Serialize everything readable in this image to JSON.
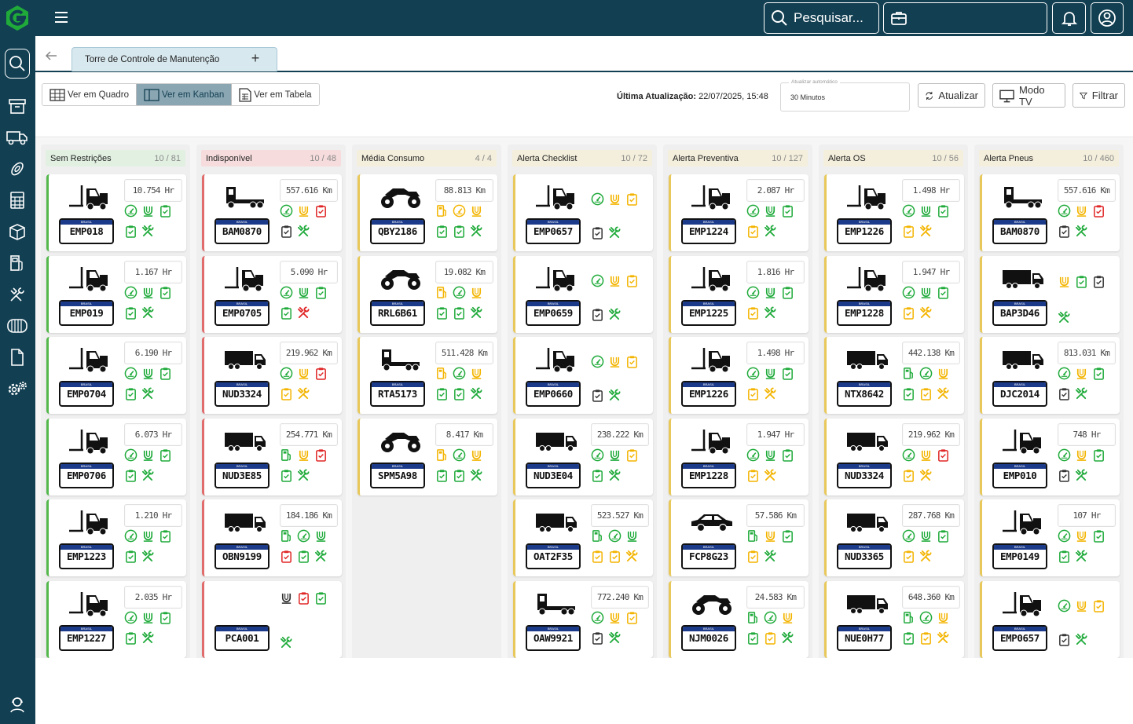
{
  "colors": {
    "brand": "#123f52",
    "green": "#1faa3a",
    "yellow": "#f3b400",
    "red": "#e02626"
  },
  "topbar": {
    "search_label": "Pesquisar..."
  },
  "tabs": {
    "active_label": "Torre de Controle de Manutenção",
    "add_label": "+"
  },
  "toolbar": {
    "views": [
      {
        "label": "Ver em Quadro"
      },
      {
        "label": "Ver em Kanban"
      },
      {
        "label": "Ver em Tabela"
      }
    ],
    "last_update_label": "Última Atualização:",
    "last_update_value": "22/07/2025, 15:48",
    "auto_update_legend": "Atualizar automático",
    "auto_update_value": "30 Minutos",
    "refresh_label": "Atualizar",
    "tv_label": "Modo TV",
    "filter_label": "Filtrar"
  },
  "plate_band_text": "BRASIL",
  "columns": [
    {
      "title": "Sem Restrições",
      "count": "10 / 81",
      "color": "green",
      "cards": [
        {
          "vehicle": "forklift",
          "plate": "EMP018",
          "meter": "10.754 Hr",
          "row1": [
            "gauge:g",
            "tire:g",
            "clip:g"
          ],
          "row2": [
            "clip:g",
            "tools:g"
          ]
        },
        {
          "vehicle": "forklift",
          "plate": "EMP019",
          "meter": "1.167 Hr",
          "row1": [
            "gauge:g",
            "tire:g",
            "clip:g"
          ],
          "row2": [
            "clip:g",
            "tools:g"
          ]
        },
        {
          "vehicle": "forklift",
          "plate": "EMP0704",
          "meter": "6.190 Hr",
          "row1": [
            "gauge:g",
            "tire:g",
            "clip:g"
          ],
          "row2": [
            "clip:g",
            "tools:g"
          ]
        },
        {
          "vehicle": "forklift",
          "plate": "EMP0706",
          "meter": "6.073 Hr",
          "row1": [
            "gauge:g",
            "tire:g",
            "clip:g"
          ],
          "row2": [
            "clip:g",
            "tools:g"
          ]
        },
        {
          "vehicle": "forklift",
          "plate": "EMP1223",
          "meter": "1.210 Hr",
          "row1": [
            "gauge:g",
            "tire:g",
            "clip:g"
          ],
          "row2": [
            "clip:g",
            "tools:g"
          ]
        },
        {
          "vehicle": "forklift",
          "plate": "EMP1227",
          "meter": "2.035 Hr",
          "row1": [
            "gauge:g",
            "tire:g",
            "clip:g"
          ],
          "row2": [
            "clip:g",
            "tools:g"
          ]
        }
      ]
    },
    {
      "title": "Indisponível",
      "count": "10 / 48",
      "color": "red",
      "cards": [
        {
          "vehicle": "tractor",
          "plate": "BAM0870",
          "meter": "557.616 Km",
          "row1": [
            "gauge:g",
            "tire:y",
            "clip:r"
          ],
          "row2": [
            "clip:k",
            "tools:g"
          ]
        },
        {
          "vehicle": "forklift",
          "plate": "EMP0705",
          "meter": "5.090 Hr",
          "row1": [
            "gauge:g",
            "tire:g",
            "clip:g"
          ],
          "row2": [
            "clip:g",
            "tools:r"
          ]
        },
        {
          "vehicle": "truck",
          "plate": "NUD3324",
          "meter": "219.962 Km",
          "row1": [
            "gauge:g",
            "tire:y",
            "clip:r"
          ],
          "row2": [
            "clip:y",
            "tools:y"
          ]
        },
        {
          "vehicle": "truck",
          "plate": "NUD3E85",
          "meter": "254.771 Km",
          "row1": [
            "fuel:g",
            "tire:y",
            "clip:r"
          ],
          "row2": [
            "clip:g",
            "tools:g"
          ]
        },
        {
          "vehicle": "truck",
          "plate": "OBN9199",
          "meter": "184.186 Km",
          "row1": [
            "fuel:g",
            "gauge:g",
            "tire:g"
          ],
          "row2": [
            "clip:r",
            "clip:g",
            "tools:g"
          ]
        },
        {
          "vehicle": "none",
          "plate": "PCA001",
          "meter": "",
          "row1": [
            "tire:k",
            "clip:r",
            "clip:g"
          ],
          "row2": [
            "tools:g"
          ]
        }
      ]
    },
    {
      "title": "Média Consumo",
      "count": "4 / 4",
      "color": "yellow",
      "cards": [
        {
          "vehicle": "atv",
          "plate": "QBY2186",
          "meter": "88.813 Km",
          "row1": [
            "fuel:y",
            "gauge:y",
            "tire:y"
          ],
          "row2": [
            "clip:g",
            "clip:g",
            "tools:g"
          ]
        },
        {
          "vehicle": "atv",
          "plate": "RRL6B61",
          "meter": "19.082 Km",
          "row1": [
            "fuel:y",
            "gauge:g",
            "tire:y"
          ],
          "row2": [
            "clip:g",
            "clip:g",
            "tools:g"
          ]
        },
        {
          "vehicle": "tractor",
          "plate": "RTA5173",
          "meter": "511.428 Km",
          "row1": [
            "fuel:y",
            "gauge:g",
            "tire:y"
          ],
          "row2": [
            "clip:g",
            "clip:g",
            "tools:g"
          ]
        },
        {
          "vehicle": "atv",
          "plate": "SPM5A98",
          "meter": "8.417 Km",
          "row1": [
            "fuel:y",
            "gauge:g",
            "tire:y"
          ],
          "row2": [
            "clip:g",
            "clip:g",
            "tools:g"
          ]
        }
      ]
    },
    {
      "title": "Alerta Checklist",
      "count": "10 / 72",
      "color": "yellow",
      "cards": [
        {
          "vehicle": "forklift",
          "plate": "EMP0657",
          "meter": "",
          "row1": [
            "gauge:g",
            "tire:y",
            "clip:y"
          ],
          "row2": [
            "clip:k",
            "tools:g"
          ]
        },
        {
          "vehicle": "forklift",
          "plate": "EMP0659",
          "meter": "",
          "row1": [
            "gauge:g",
            "tire:y",
            "clip:y"
          ],
          "row2": [
            "clip:k",
            "tools:g"
          ]
        },
        {
          "vehicle": "forklift",
          "plate": "EMP0660",
          "meter": "",
          "row1": [
            "gauge:g",
            "tire:y",
            "clip:y"
          ],
          "row2": [
            "clip:k",
            "tools:g"
          ]
        },
        {
          "vehicle": "truck",
          "plate": "NUD3E04",
          "meter": "238.222 Km",
          "row1": [
            "gauge:g",
            "tire:g",
            "clip:y"
          ],
          "row2": [
            "clip:g",
            "tools:g"
          ]
        },
        {
          "vehicle": "truck",
          "plate": "OAT2F35",
          "meter": "523.527 Km",
          "row1": [
            "fuel:g",
            "gauge:g",
            "tire:g"
          ],
          "row2": [
            "clip:y",
            "clip:y",
            "tools:y"
          ]
        },
        {
          "vehicle": "tractor",
          "plate": "OAW9921",
          "meter": "772.240 Km",
          "row1": [
            "gauge:g",
            "tire:y",
            "clip:y"
          ],
          "row2": [
            "clip:k",
            "tools:g"
          ]
        }
      ]
    },
    {
      "title": "Alerta Preventiva",
      "count": "10 / 127",
      "color": "yellow",
      "cards": [
        {
          "vehicle": "forklift",
          "plate": "EMP1224",
          "meter": "2.087 Hr",
          "row1": [
            "gauge:g",
            "tire:g",
            "clip:g"
          ],
          "row2": [
            "clip:y",
            "tools:g"
          ]
        },
        {
          "vehicle": "forklift",
          "plate": "EMP1225",
          "meter": "1.816 Hr",
          "row1": [
            "gauge:g",
            "tire:g",
            "clip:g"
          ],
          "row2": [
            "clip:y",
            "tools:g"
          ]
        },
        {
          "vehicle": "forklift",
          "plate": "EMP1226",
          "meter": "1.498 Hr",
          "row1": [
            "gauge:g",
            "tire:g",
            "clip:g"
          ],
          "row2": [
            "clip:y",
            "tools:y"
          ]
        },
        {
          "vehicle": "forklift",
          "plate": "EMP1228",
          "meter": "1.947 Hr",
          "row1": [
            "gauge:g",
            "tire:g",
            "clip:g"
          ],
          "row2": [
            "clip:y",
            "tools:y"
          ]
        },
        {
          "vehicle": "car",
          "plate": "FCP8G23",
          "meter": "57.586 Km",
          "row1": [
            "fuel:g",
            "tire:y",
            "clip:g"
          ],
          "row2": [
            "clip:y",
            "tools:g"
          ]
        },
        {
          "vehicle": "atv",
          "plate": "NJM0026",
          "meter": "24.583 Km",
          "row1": [
            "fuel:g",
            "gauge:g",
            "tire:y"
          ],
          "row2": [
            "clip:g",
            "clip:y",
            "tools:g"
          ]
        }
      ]
    },
    {
      "title": "Alerta OS",
      "count": "10 / 56",
      "color": "yellow",
      "cards": [
        {
          "vehicle": "forklift",
          "plate": "EMP1226",
          "meter": "1.498 Hr",
          "row1": [
            "gauge:g",
            "tire:g",
            "clip:g"
          ],
          "row2": [
            "clip:y",
            "tools:y"
          ]
        },
        {
          "vehicle": "forklift",
          "plate": "EMP1228",
          "meter": "1.947 Hr",
          "row1": [
            "gauge:g",
            "tire:g",
            "clip:g"
          ],
          "row2": [
            "clip:y",
            "tools:y"
          ]
        },
        {
          "vehicle": "truck",
          "plate": "NTX8642",
          "meter": "442.138 Km",
          "row1": [
            "fuel:g",
            "gauge:g",
            "tire:y"
          ],
          "row2": [
            "clip:g",
            "clip:y",
            "tools:y"
          ]
        },
        {
          "vehicle": "truck",
          "plate": "NUD3324",
          "meter": "219.962 Km",
          "row1": [
            "gauge:g",
            "tire:y",
            "clip:r"
          ],
          "row2": [
            "clip:y",
            "tools:y"
          ]
        },
        {
          "vehicle": "truck",
          "plate": "NUD3365",
          "meter": "287.768 Km",
          "row1": [
            "gauge:g",
            "tire:g",
            "clip:g"
          ],
          "row2": [
            "clip:y",
            "tools:y"
          ]
        },
        {
          "vehicle": "truck",
          "plate": "NUE0H77",
          "meter": "648.360 Km",
          "row1": [
            "fuel:g",
            "gauge:g",
            "tire:y"
          ],
          "row2": [
            "clip:g",
            "clip:y",
            "tools:y"
          ]
        }
      ]
    },
    {
      "title": "Alerta Pneus",
      "count": "10 / 460",
      "color": "yellow",
      "cards": [
        {
          "vehicle": "tractor",
          "plate": "BAM0870",
          "meter": "557.616 Km",
          "row1": [
            "gauge:g",
            "tire:y",
            "clip:r"
          ],
          "row2": [
            "clip:k",
            "tools:g"
          ]
        },
        {
          "vehicle": "truck",
          "plate": "BAP3D46",
          "meter": "",
          "row1": [
            "tire:y",
            "clip:g",
            "clip:k"
          ],
          "row2": [
            "tools:g"
          ]
        },
        {
          "vehicle": "truck",
          "plate": "DJC2014",
          "meter": "813.031 Km",
          "row1": [
            "gauge:g",
            "tire:y",
            "clip:g"
          ],
          "row2": [
            "clip:k",
            "tools:g"
          ]
        },
        {
          "vehicle": "forklift",
          "plate": "EMP010",
          "meter": "748 Hr",
          "row1": [
            "gauge:g",
            "tire:y",
            "clip:g"
          ],
          "row2": [
            "clip:k",
            "tools:g"
          ]
        },
        {
          "vehicle": "forklift",
          "plate": "EMP0149",
          "meter": "107 Hr",
          "row1": [
            "gauge:g",
            "tire:y",
            "clip:g"
          ],
          "row2": [
            "clip:g",
            "tools:g"
          ]
        },
        {
          "vehicle": "forklift",
          "plate": "EMP0657",
          "meter": "",
          "row1": [
            "gauge:g",
            "tire:y",
            "clip:y"
          ],
          "row2": [
            "clip:k",
            "tools:g"
          ]
        }
      ]
    }
  ]
}
